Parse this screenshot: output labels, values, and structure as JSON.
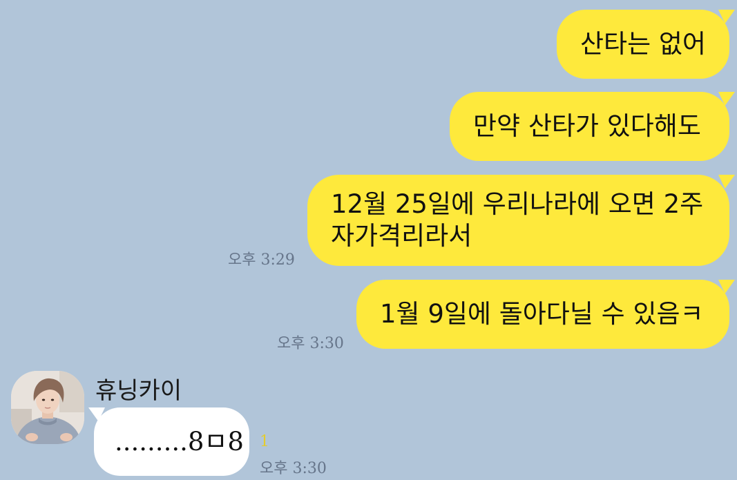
{
  "chat": {
    "sent": [
      {
        "text": "산타는 없어"
      },
      {
        "text": "만약 산타가 있다해도"
      },
      {
        "line1": "12월 25일에 우리나라에 오면 2주",
        "line2": "자가격리라서",
        "time": "오후 3:29"
      },
      {
        "text": "1월 9일에 돌아다닐 수 있음ㅋ",
        "time": "오후 3:30"
      }
    ],
    "received": {
      "sender": "휴닝카이",
      "text": ".........8ㅁ8",
      "unread_count": "1",
      "time": "오후 3:30"
    }
  },
  "colors": {
    "background": "#b1c5d9",
    "sent_bubble": "#fee93c",
    "received_bubble": "#ffffff",
    "unread": "#e4cc2c",
    "timestamp": "#66758a"
  },
  "icons": {
    "avatar": "profile-photo"
  }
}
